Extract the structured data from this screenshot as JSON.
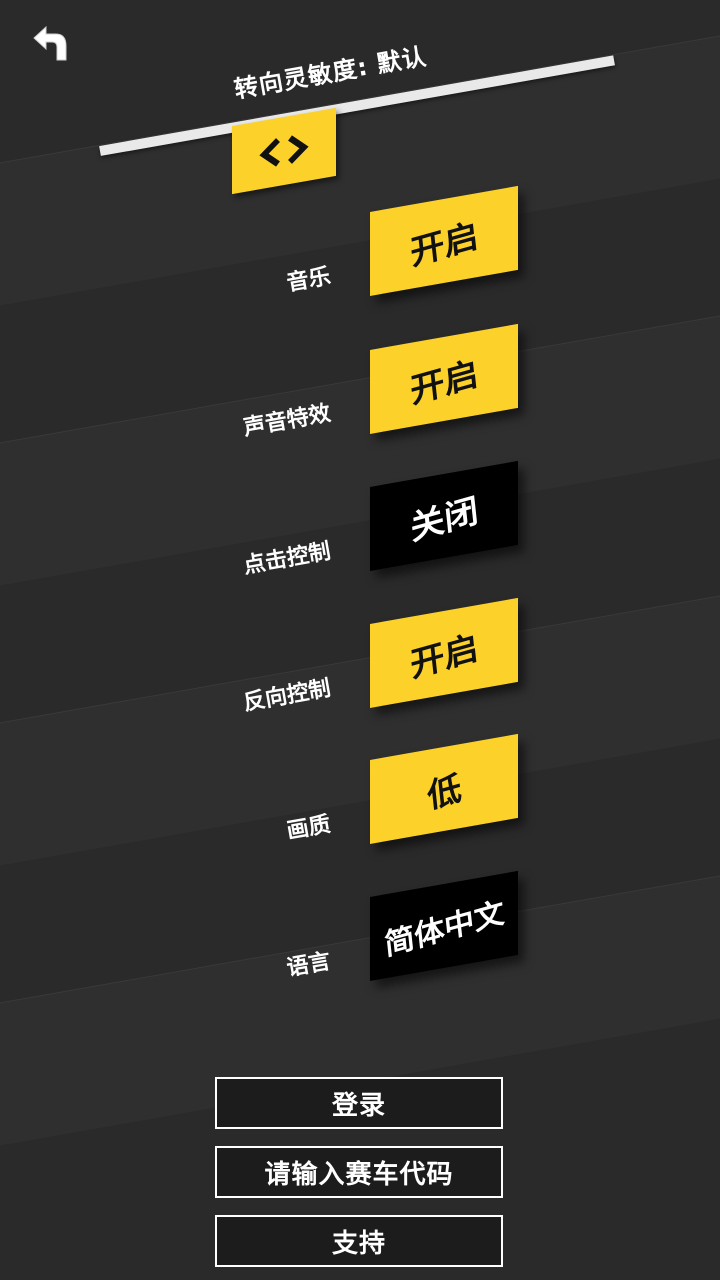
{
  "header": {
    "steering_label": "转向灵敏度: 默认"
  },
  "slider": {
    "handle_glyph": "<>",
    "value": "默认"
  },
  "settings": [
    {
      "label": "音乐",
      "value": "开启",
      "style": "yellow"
    },
    {
      "label": "声音特效",
      "value": "开启",
      "style": "yellow"
    },
    {
      "label": "点击控制",
      "value": "关闭",
      "style": "black"
    },
    {
      "label": "反向控制",
      "value": "开启",
      "style": "yellow"
    },
    {
      "label": "画质",
      "value": "低",
      "style": "yellow"
    },
    {
      "label": "语言",
      "value": "简体中文",
      "style": "black"
    }
  ],
  "menu": {
    "login": "登录",
    "enter_code": "请输入赛车代码",
    "support": "支持"
  },
  "colors": {
    "accent": "#fcd12a",
    "background": "#2a2a2a",
    "dark_button": "#000000"
  },
  "icons": {
    "back": "back-arrow-icon",
    "slider": "chevrons-icon"
  }
}
